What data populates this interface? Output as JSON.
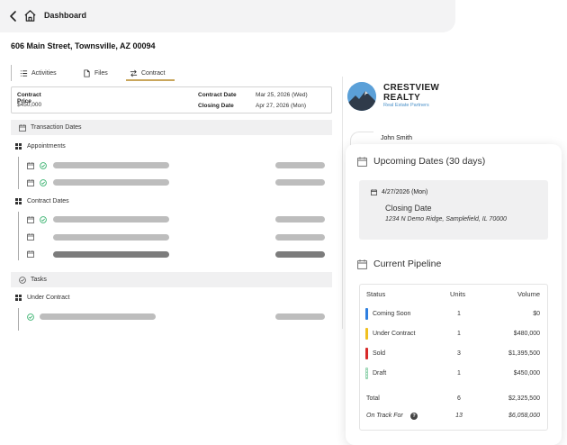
{
  "topbar": {
    "title": "Dashboard"
  },
  "property": {
    "address": "606 Main Street, Townsville, AZ 00094"
  },
  "tabs": [
    {
      "label": "Activities",
      "icon": "list-icon"
    },
    {
      "label": "Files",
      "icon": "file-icon"
    },
    {
      "label": "Contract",
      "icon": "swap-arrows-icon",
      "active": true
    }
  ],
  "contract": {
    "contract_label": "Contract",
    "price_label": "Price",
    "price_value": "$450,000",
    "contract_date_label": "Contract Date",
    "contract_date_value": "Mar 25, 2026 (Wed)",
    "closing_date_label": "Closing Date",
    "closing_date_value": "Apr 27, 2026 (Mon)"
  },
  "sections": {
    "transaction_dates": "Transaction Dates",
    "appointments": "Appointments",
    "contract_dates": "Contract Dates",
    "tasks": "Tasks",
    "under_contract": "Under Contract"
  },
  "brand": {
    "name_line1": "CRESTVIEW",
    "name_line2": "REALTY",
    "tagline": "Real Estate Partners",
    "colors": {
      "sky": "#5ba0d8",
      "mountain": "#2f3b4a",
      "tagline": "#4a90c8"
    }
  },
  "agent": {
    "name": "John Smith"
  },
  "upcoming": {
    "heading": "Upcoming Dates (30 days)",
    "event": {
      "date": "4/27/2026 (Mon)",
      "title": "Closing Date",
      "address": "1234 N Demo Ridge, Samplefield, IL 70000"
    }
  },
  "pipeline": {
    "heading": "Current Pipeline",
    "columns": {
      "status": "Status",
      "units": "Units",
      "volume": "Volume"
    },
    "rows": [
      {
        "status": "Coming Soon",
        "units": "1",
        "volume": "$0",
        "color": "#2f7fe0"
      },
      {
        "status": "Under Contract",
        "units": "1",
        "volume": "$480,000",
        "color": "#f0c020"
      },
      {
        "status": "Sold",
        "units": "3",
        "volume": "$1,395,500",
        "color": "#d82a2a"
      },
      {
        "status": "Draft",
        "units": "1",
        "volume": "$450,000",
        "color": "#9ad6b4"
      }
    ],
    "total": {
      "label": "Total",
      "units": "6",
      "volume": "$2,325,500"
    },
    "on_track": {
      "label": "On Track For",
      "units": "13",
      "volume": "$6,058,000"
    }
  },
  "colors": {
    "accent_underline": "#c9a65c",
    "check_green": "#3cb371"
  }
}
